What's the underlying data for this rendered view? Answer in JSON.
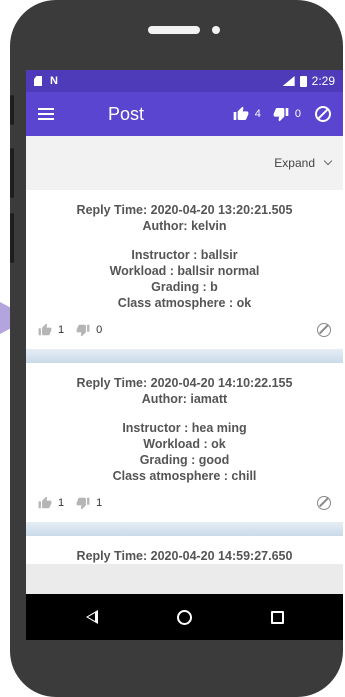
{
  "statusbar": {
    "time": "2:29"
  },
  "appbar": {
    "title": "Post",
    "like_count": "4",
    "dislike_count": "0"
  },
  "toolbar": {
    "expand_label": "Expand"
  },
  "posts": [
    {
      "reply_time": "Reply Time: 2020-04-20 13:20:21.505",
      "author": "Author: kelvin",
      "instructor": "Instructor : ballsir",
      "workload": "Workload : ballsir normal",
      "grading": "Grading : b",
      "atmosphere": "Class atmosphere : ok",
      "likes": "1",
      "dislikes": "0"
    },
    {
      "reply_time": "Reply Time: 2020-04-20 14:10:22.155",
      "author": "Author: iamatt",
      "instructor": "Instructor : hea ming",
      "workload": "Workload : ok",
      "grading": "Grading : good",
      "atmosphere": "Class atmosphere : chill",
      "likes": "1",
      "dislikes": "1"
    },
    {
      "reply_time": "Reply Time: 2020-04-20 14:59:27.650"
    }
  ],
  "colors": {
    "status_bar": "#4d3bb9",
    "app_bar": "#5a45d0",
    "nav_bar": "#000000",
    "phone_frame": "#3b3b3b",
    "arrow": "#b3a4dd"
  },
  "icons": [
    "menu-icon",
    "thumbs-up-icon",
    "thumbs-down-icon",
    "ban-icon",
    "chevron-down-icon",
    "back-icon",
    "home-icon",
    "recents-icon"
  ]
}
